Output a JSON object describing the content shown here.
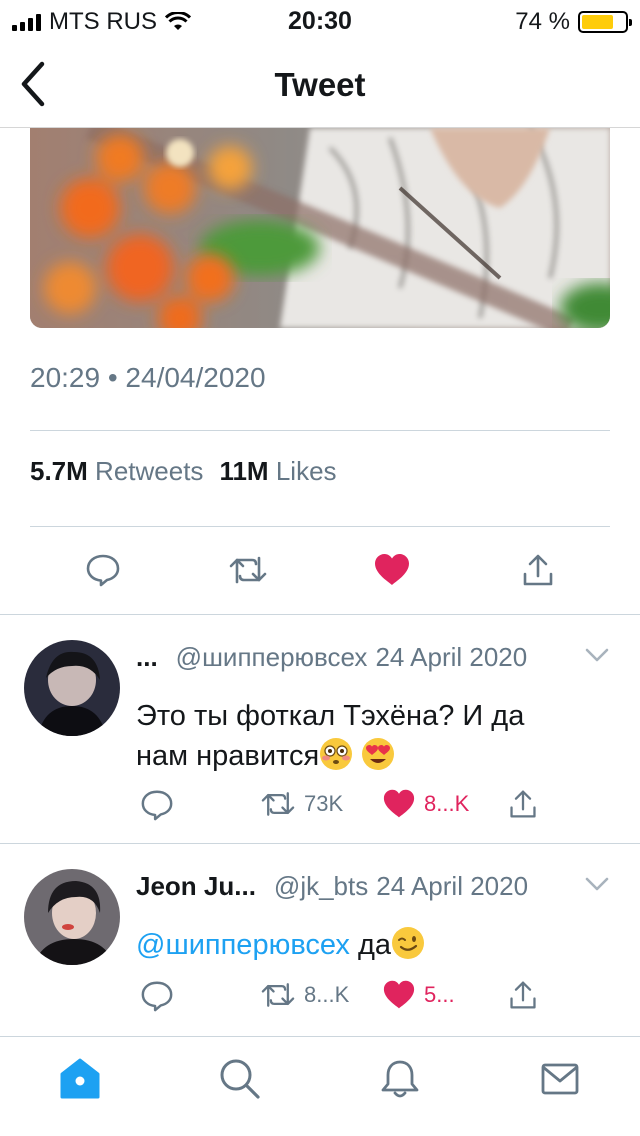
{
  "status": {
    "carrier": "MTS RUS",
    "time": "20:30",
    "battery_pct": "74 %",
    "battery_level": 0.74
  },
  "header": {
    "title": "Tweet"
  },
  "tweet": {
    "timestamp": "20:29 • 24/04/2020",
    "retweets_count": "5.7M",
    "retweets_label": "Retweets",
    "likes_count": "11M",
    "likes_label": "Likes"
  },
  "replies": [
    {
      "name": "...",
      "handle": "@шипперювсех",
      "date": "24 April 2020",
      "text_line1": "Это ты фоткал Тэхёна? И да",
      "text_line2": "нам нравится",
      "retweets": "73K",
      "likes": "8...K"
    },
    {
      "name": "Jeon Ju...",
      "handle": "@jk_bts",
      "date": "24 April 2020",
      "mention": "@шипперювсех",
      "text": " да",
      "retweets": "8...K",
      "likes": "5..."
    }
  ],
  "colors": {
    "accent": "#1da1f2",
    "like": "#e0245e",
    "muted": "#657786",
    "battery": "#fecc0a"
  }
}
